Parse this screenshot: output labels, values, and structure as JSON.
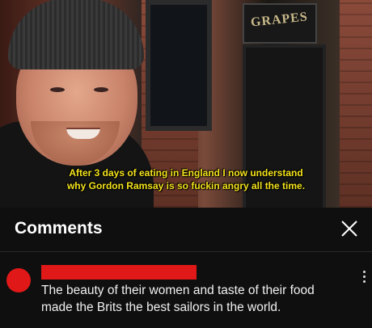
{
  "video": {
    "sign_text": "GRAPES",
    "caption_lines": [
      "After 3 days of eating in England I now understand",
      "why Gordon Ramsay is so fuckin angry all the time."
    ]
  },
  "comments_panel": {
    "title": "Comments",
    "comments": [
      {
        "text_lines": [
          "The beauty of their women and taste of their food",
          "made the Brits the best sailors in the world."
        ]
      }
    ]
  },
  "colors": {
    "caption": "#f4e31c",
    "redaction": "#e01818",
    "panel_bg": "#0f0f0f"
  }
}
